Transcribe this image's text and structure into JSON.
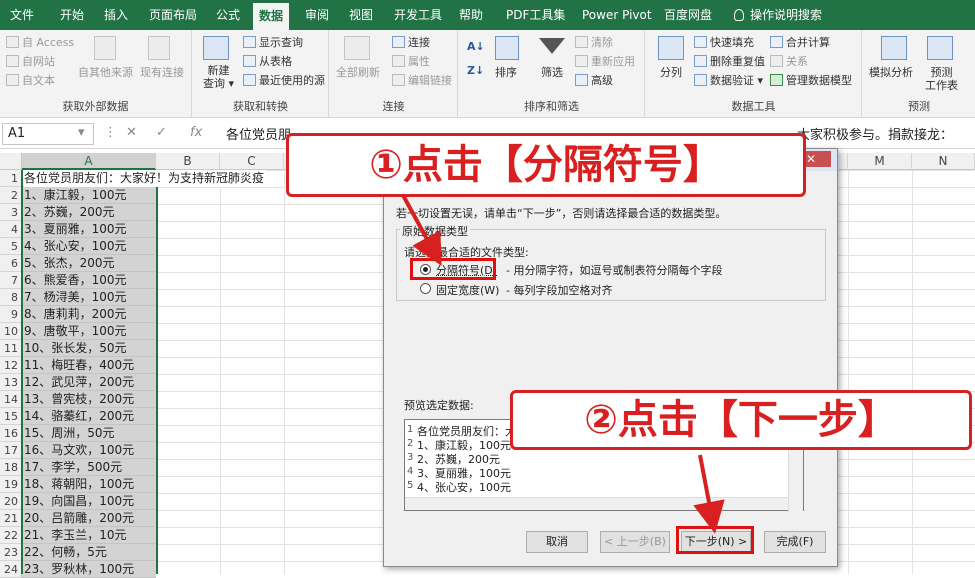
{
  "menu": {
    "tabs": [
      "文件",
      "开始",
      "插入",
      "页面布局",
      "公式",
      "数据",
      "审阅",
      "视图",
      "开发工具",
      "帮助",
      "PDF工具集",
      "Power Pivot",
      "百度网盘"
    ],
    "active": "数据",
    "search": "操作说明搜索"
  },
  "ribbon": {
    "ext": {
      "items": [
        "自 Access",
        "自网站",
        "自文本"
      ],
      "other_source": "自其他来源",
      "existing": "现有连接",
      "label": "获取外部数据"
    },
    "transform": {
      "new_query_1": "新建",
      "new_query_2": "查询",
      "items": [
        "显示查询",
        "从表格",
        "最近使用的源"
      ],
      "label": "获取和转换"
    },
    "conn": {
      "refresh_all": "全部刷新",
      "items": [
        "连接",
        "属性",
        "编辑链接"
      ],
      "label": "连接"
    },
    "sort": {
      "sort_label": "排序",
      "filter_label": "筛选",
      "items": [
        "清除",
        "重新应用",
        "高级"
      ],
      "label": "排序和筛选"
    },
    "tools": {
      "split": "分列",
      "items": [
        "快速填充",
        "删除重复值",
        "数据验证",
        "合并计算",
        "关系",
        "管理数据模型"
      ],
      "label": "数据工具"
    },
    "forecast": {
      "whatif": "模拟分析",
      "sheet_1": "预测",
      "sheet_2": "工作表",
      "label": "预测"
    }
  },
  "formula_bar": {
    "name_box": "A1",
    "fx": "fx",
    "text": "各位党员朋",
    "text_right": "大家积极参与。捐款接龙："
  },
  "columns": [
    "A",
    "B",
    "C",
    "M",
    "N"
  ],
  "rows": [
    "1",
    "2",
    "3",
    "4",
    "5",
    "6",
    "7",
    "8",
    "9",
    "10",
    "11",
    "12",
    "13",
    "14",
    "15",
    "16",
    "17",
    "18",
    "19",
    "20",
    "21",
    "22",
    "23",
    "24"
  ],
  "cells": [
    "各位党员朋友们：大家好！为支持新冠肺炎疫",
    "1、康江毅，100元",
    "2、苏巍，200元",
    "3、夏丽雅，100元",
    "4、张心安，100元",
    "5、张杰，200元",
    "6、熊爱香，100元",
    "7、杨浔美，100元",
    "8、唐莉莉，200元",
    "9、唐敬平，100元",
    "10、张长发，50元",
    "11、梅旺春，400元",
    "12、武见萍，200元",
    "13、曾宪枝，200元",
    "14、骆蓁红，200元",
    "15、周洲，50元",
    "16、马文欢，100元",
    "17、李学，500元",
    "18、蒋朝阳，100元",
    "19、向国昌，100元",
    "20、吕箭雕，200元",
    "21、李玉兰，10元",
    "22、何畅，5元",
    "23、罗秋林，100元"
  ],
  "dialog": {
    "close": "✕",
    "instruction": "若一切设置无误，请单击“下一步”，否则请选择最合适的数据类型。",
    "group_title": "原始数据类型",
    "choose_label": "请选择最合适的文件类型:",
    "opt_delimited": "分隔符号(D)",
    "opt_delimited_desc": "- 用分隔字符，如逗号或制表符分隔每个字段",
    "opt_fixed": "固定宽度(W)",
    "opt_fixed_desc": "- 每列字段加空格对齐",
    "preview_label": "预览选定数据:",
    "preview_nums": [
      "1",
      "2",
      "3",
      "4",
      "5"
    ],
    "preview_lines": [
      "各位党员朋友们：大",
      "1、康江毅，100元",
      "2、苏巍，200元",
      "3、夏丽雅，100元",
      "4、张心安，100元"
    ],
    "btn_cancel": "取消",
    "btn_prev": "< 上一步(B)",
    "btn_next": "下一步(N) >",
    "btn_finish": "完成(F)"
  },
  "annotations": {
    "step1": "①点击【分隔符号】",
    "step2": "②点击【下一步】",
    "color": "#d92020"
  }
}
